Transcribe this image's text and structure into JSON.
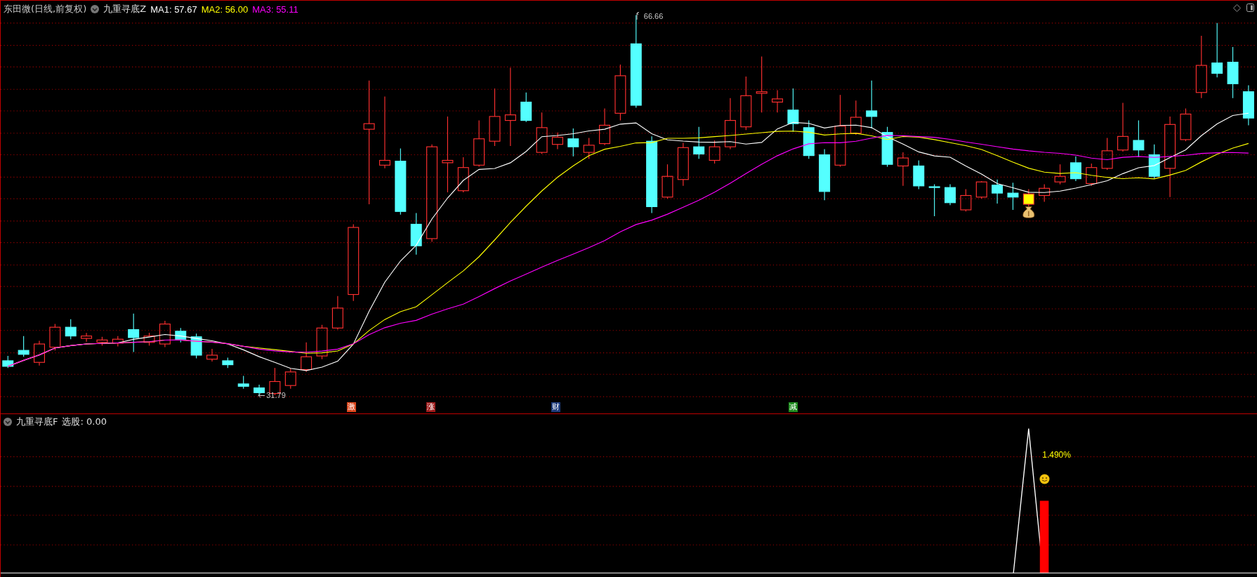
{
  "header": {
    "title": "东田微(日线,前复权)",
    "indicator": "九重寻底Z",
    "ma": [
      {
        "label": "MA1: 57.67",
        "color": "#ffffff"
      },
      {
        "label": "MA2: 56.00",
        "color": "#ffff00"
      },
      {
        "label": "MA3: 55.11",
        "color": "#ff00ff"
      }
    ]
  },
  "price_labels": [
    {
      "kind": "high",
      "text": "66.66"
    },
    {
      "kind": "low",
      "text": "31.79"
    }
  ],
  "signals": [
    {
      "text": "激",
      "color": "#d9461c"
    },
    {
      "text": "涨",
      "color": "#9c1a1a"
    },
    {
      "text": "财",
      "color": "#1b3a7a"
    },
    {
      "text": "减",
      "color": "#1d8a1d"
    }
  ],
  "lower_panel": {
    "indicator": "九重寻底F",
    "value": "选股: 0.00",
    "annotation": "1.490%"
  }
}
